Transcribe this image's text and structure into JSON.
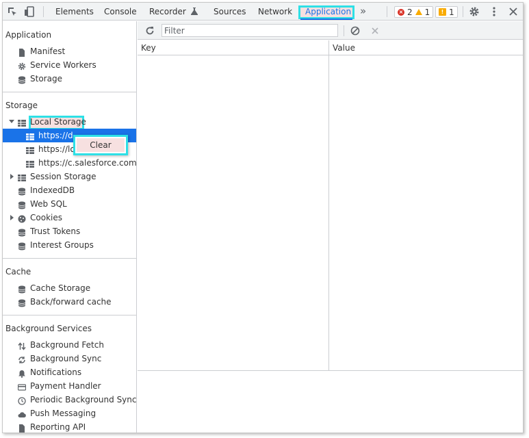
{
  "topbar": {
    "tabs": [
      "Elements",
      "Console",
      "Recorder",
      "Sources",
      "Network",
      "Application"
    ],
    "more": "»",
    "errors": "2",
    "warnings": "1",
    "issues": "1"
  },
  "sidebar": {
    "application_title": "Application",
    "application_items": [
      "Manifest",
      "Service Workers",
      "Storage"
    ],
    "storage_title": "Storage",
    "storage_items": [
      "Local Storage",
      "https://d",
      "https://lo",
      "https://c.salesforce.com",
      "Session Storage",
      "IndexedDB",
      "Web SQL",
      "Cookies",
      "Trust Tokens",
      "Interest Groups"
    ],
    "cache_title": "Cache",
    "cache_items": [
      "Cache Storage",
      "Back/forward cache"
    ],
    "bg_title": "Background Services",
    "bg_items": [
      "Background Fetch",
      "Background Sync",
      "Notifications",
      "Payment Handler",
      "Periodic Background Sync",
      "Push Messaging",
      "Reporting API"
    ]
  },
  "context_menu": {
    "clear": "Clear"
  },
  "toolbar": {
    "filter_placeholder": "Filter",
    "filter_value": ""
  },
  "grid": {
    "key_header": "Key",
    "value_header": "Value",
    "rows": []
  }
}
